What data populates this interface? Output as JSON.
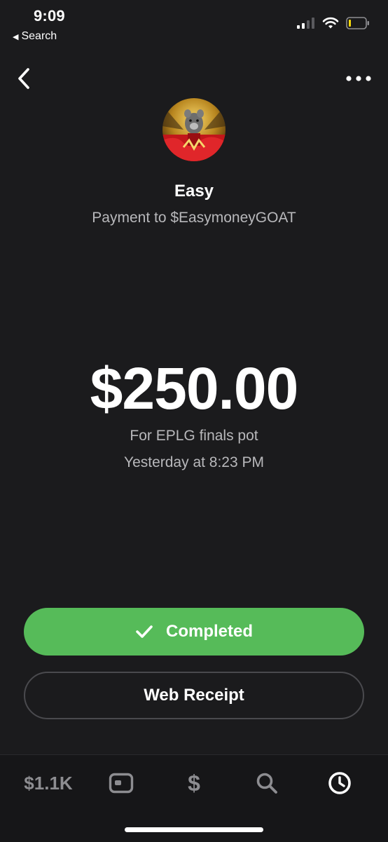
{
  "status_bar": {
    "time": "9:09",
    "back_label": "Search",
    "battery_color": "#f5d90a"
  },
  "nav": {
    "back_icon": "chevron-left-icon",
    "more_icon": "more-horizontal-icon"
  },
  "recipient": {
    "name": "Easy",
    "payment_line": "Payment to $EasymoneyGOAT"
  },
  "payment": {
    "amount": "$250.00",
    "note": "For EPLG finals pot",
    "date": "Yesterday at 8:23 PM"
  },
  "actions": {
    "completed_label": "Completed",
    "completed_color": "#56bb59",
    "receipt_label": "Web Receipt"
  },
  "tabbar": {
    "balance": "$1.1K",
    "cash_symbol": "$",
    "icons": [
      "card-icon",
      "dollar-icon",
      "search-icon",
      "clock-icon"
    ]
  }
}
